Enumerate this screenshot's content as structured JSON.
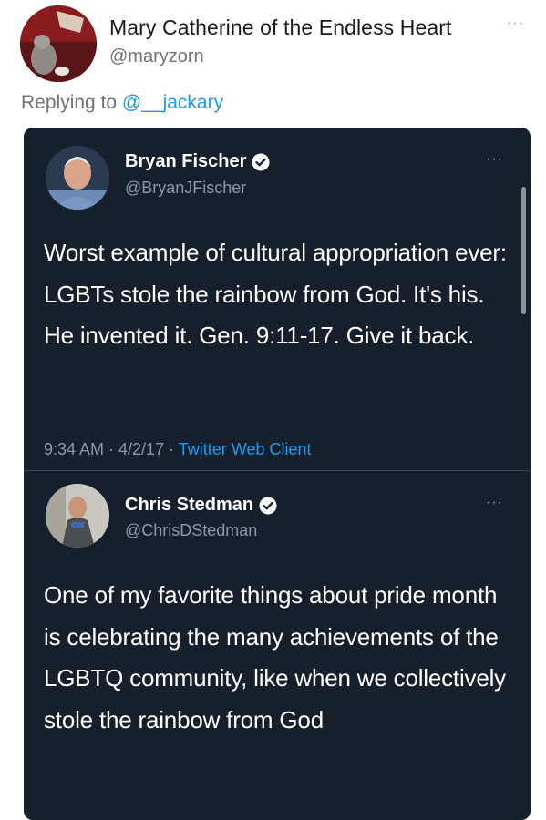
{
  "outer": {
    "name": "Mary Catherine of the Endless Heart",
    "handle": "@maryzorn",
    "more": "···",
    "replying_prefix": "Replying to ",
    "replying_mention": "@__jackary"
  },
  "tweets": [
    {
      "name": "Bryan Fischer",
      "handle": "@BryanJFischer",
      "more": "···",
      "verified": true,
      "text": "Worst example of cultural appropriation ever: LGBTs stole the rainbow from God. It's his. He invented it. Gen. 9:11-17. Give it back.",
      "time": "9:34 AM · 4/2/17 · ",
      "client": "Twitter Web Client"
    },
    {
      "name": "Chris Stedman",
      "handle": "@ChrisDStedman",
      "more": "···",
      "verified": true,
      "text": "One of my favorite things about pride month is celebrating the many achievements of the LGBTQ community, like when we collectively stole the rainbow from God"
    }
  ],
  "colors": {
    "dark_bg": "#16202d",
    "accent": "#1d9bf0",
    "secondary_text": "#8b98a5"
  }
}
